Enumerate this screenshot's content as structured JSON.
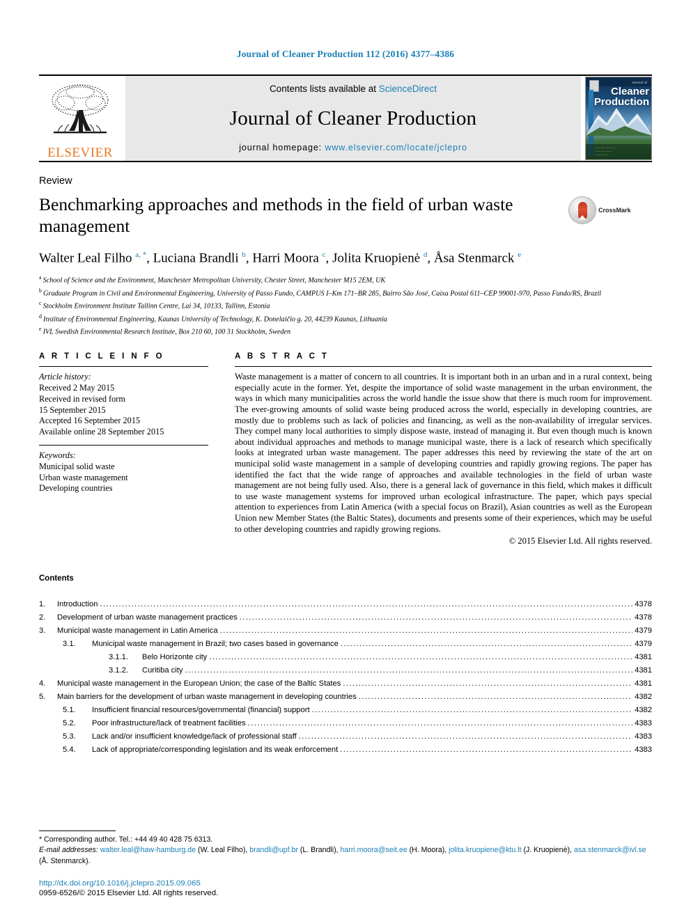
{
  "running_head": "Journal of Cleaner Production 112 (2016) 4377–4386",
  "masthead": {
    "publisher": "ELSEVIER",
    "contents_prefix": "Contents lists available at ",
    "contents_link": "ScienceDirect",
    "journal_title": "Journal of Cleaner Production",
    "homepage_prefix": "journal homepage: ",
    "homepage_url": "www.elsevier.com/locate/jclepro",
    "cover": {
      "line1": "Cleaner",
      "line2": "Production",
      "top_small": "Journal of"
    }
  },
  "article": {
    "kind": "Review",
    "title": "Benchmarking approaches and methods in the field of urban waste management",
    "crossmark_label": "CrossMark",
    "authors_html": "Walter Leal Filho <sup>a, *</sup>, Luciana Brandli <sup>b</sup>, Harri Moora <sup>c</sup>, Jolita Kruopienė <sup>d</sup>, Åsa Stenmarck <sup>e</sup>",
    "affiliations": [
      {
        "mark": "a",
        "text": "School of Science and the Environment, Manchester Metropolitan University, Chester Street, Manchester M15 2EM, UK"
      },
      {
        "mark": "b",
        "text": "Graduate Program in Civil and Environmental Engineering, University of Passo Fundo, CAMPUS I–Km 171–BR 285, Bairro São José, Caixa Postal 611–CEP 99001-970, Passo Fundo/RS, Brazil"
      },
      {
        "mark": "c",
        "text": "Stockholm Environment Institute Tallinn Centre, Lai 34, 10133, Tallinn, Estonia"
      },
      {
        "mark": "d",
        "text": "Institute of Environmental Engineering, Kaunas University of Technology, K. Donelaičio g. 20, 44239 Kaunas, Lithuania"
      },
      {
        "mark": "e",
        "text": "IVL Swedish Environmental Research Institute, Box 210 60, 100 31 Stockholm, Sweden"
      }
    ]
  },
  "article_info": {
    "heading": "A R T I C L E  I N F O",
    "history_label": "Article history:",
    "history": [
      "Received 2 May 2015",
      "Received in revised form",
      "15 September 2015",
      "Accepted 16 September 2015",
      "Available online 28 September 2015"
    ],
    "keywords_label": "Keywords:",
    "keywords": [
      "Municipal solid waste",
      "Urban waste management",
      "Developing countries"
    ]
  },
  "abstract": {
    "heading": "A B S T R A C T",
    "text": "Waste management is a matter of concern to all countries. It is important both in an urban and in a rural context, being especially acute in the former. Yet, despite the importance of solid waste management in the urban environment, the ways in which many municipalities across the world handle the issue show that there is much room for improvement. The ever-growing amounts of solid waste being produced across the world, especially in developing countries, are mostly due to problems such as lack of policies and financing, as well as the non-availability of irregular services. They compel many local authorities to simply dispose waste, instead of managing it. But even though much is known about individual approaches and methods to manage municipal waste, there is a lack of research which specifically looks at integrated urban waste management. The paper addresses this need by reviewing the state of the art on municipal solid waste management in a sample of developing countries and rapidly growing regions. The paper has identified the fact that the wide range of approaches and available technologies in the field of urban waste management are not being fully used. Also, there is a general lack of governance in this field, which makes it difficult to use waste management systems for improved urban ecological infrastructure. The paper, which pays special attention to experiences from Latin America (with a special focus on Brazil), Asian countries as well as the European Union new Member States (the Baltic States), documents and presents some of their experiences, which may be useful to other developing countries and rapidly growing regions.",
    "copyright": "© 2015 Elsevier Ltd. All rights reserved."
  },
  "contents": {
    "heading": "Contents",
    "entries": [
      {
        "level": 1,
        "num": "1.",
        "label": "Introduction",
        "page": "4378"
      },
      {
        "level": 1,
        "num": "2.",
        "label": "Development of urban waste management practices",
        "page": "4378"
      },
      {
        "level": 1,
        "num": "3.",
        "label": "Municipal waste management in Latin America",
        "page": "4379"
      },
      {
        "level": 2,
        "num": "3.1.",
        "label": "Municipal waste management in Brazil; two cases based in governance",
        "page": "4379"
      },
      {
        "level": 3,
        "num": "3.1.1.",
        "label": "Belo Horizonte city",
        "page": "4381"
      },
      {
        "level": 3,
        "num": "3.1.2.",
        "label": "Curitiba city",
        "page": "4381"
      },
      {
        "level": 1,
        "num": "4.",
        "label": "Municipal waste management in the European Union; the case of the Baltic States",
        "page": "4381"
      },
      {
        "level": 1,
        "num": "5.",
        "label": "Main barriers for the development of urban waste management in developing countries",
        "page": "4382"
      },
      {
        "level": 2,
        "num": "5.1.",
        "label": "Insufficient financial resources/governmental (financial) support",
        "page": "4382"
      },
      {
        "level": 2,
        "num": "5.2.",
        "label": "Poor infrastructure/lack of treatment facilities",
        "page": "4383"
      },
      {
        "level": 2,
        "num": "5.3.",
        "label": "Lack and/or insufficient knowledge/lack of professional staff",
        "page": "4383"
      },
      {
        "level": 2,
        "num": "5.4.",
        "label": "Lack of appropriate/corresponding legislation and its weak enforcement",
        "page": "4383"
      }
    ]
  },
  "footnotes": {
    "corresponding": "* Corresponding author. Tel.: +44 49 40 428 75 6313.",
    "email_label": "E-mail addresses:",
    "emails": [
      {
        "address": "walter.leal@haw-hamburg.de",
        "name": "(W. Leal Filho)"
      },
      {
        "address": "brandli@upf.br",
        "name": "(L. Brandli)"
      },
      {
        "address": "harri.moora@seit.ee",
        "name": "(H. Moora)"
      },
      {
        "address": "jolita.kruopiene@ktu.lt",
        "name": "(J. Kruopienė)"
      },
      {
        "address": "asa.stenmarck@ivl.se",
        "name": "(Å. Stenmarck)"
      }
    ],
    "doi": "http://dx.doi.org/10.1016/j.jclepro.2015.09.065",
    "issn": "0959-6526/© 2015 Elsevier Ltd. All rights reserved."
  }
}
